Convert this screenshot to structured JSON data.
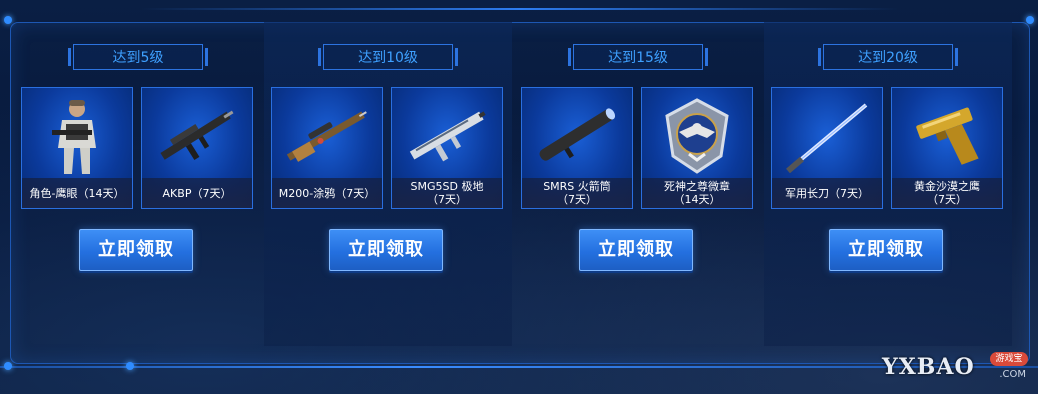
{
  "tiers": [
    {
      "level": "达到5级",
      "items": [
        {
          "name": "角色-鹰眼（14天）",
          "icon": "soldier-character-icon"
        },
        {
          "name": "AKBP（7天）",
          "icon": "rifle-icon"
        }
      ],
      "button": "立即领取"
    },
    {
      "level": "达到10级",
      "items": [
        {
          "name": "M200-涂鸦（7天）",
          "icon": "sniper-rifle-icon"
        },
        {
          "name": "SMG5SD 极地\n（7天）",
          "icon": "smg-icon"
        }
      ],
      "button": "立即领取"
    },
    {
      "level": "达到15级",
      "items": [
        {
          "name": "SMRS 火箭筒\n（7天）",
          "icon": "rocket-launcher-icon"
        },
        {
          "name": "死神之尊微章\n（14天）",
          "icon": "eagle-badge-icon"
        }
      ],
      "button": "立即领取"
    },
    {
      "level": "达到20级",
      "items": [
        {
          "name": "军用长刀（7天）",
          "icon": "long-blade-icon"
        },
        {
          "name": "黄金沙漠之鹰\n（7天）",
          "icon": "golden-pistol-icon"
        }
      ],
      "button": "立即领取"
    }
  ],
  "watermark": {
    "logo": "YXBAO",
    "badge": "游戏宝",
    "domain": ".COM"
  },
  "colors": {
    "accent": "#3ea0ff",
    "button": "#2470e0",
    "frame": "#1d57b3"
  }
}
